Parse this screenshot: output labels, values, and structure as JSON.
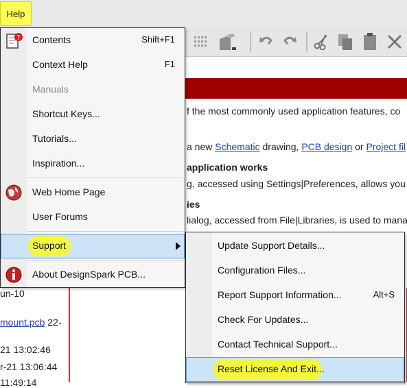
{
  "menubar": {
    "help_label": "Help"
  },
  "help_menu": {
    "items": [
      {
        "label": "Contents",
        "shortcut": "Shift+F1"
      },
      {
        "label": "Context Help",
        "shortcut": "F1"
      },
      {
        "label": "Manuals",
        "shortcut": ""
      },
      {
        "label": "Shortcut Keys...",
        "shortcut": ""
      },
      {
        "label": "Tutorials...",
        "shortcut": ""
      },
      {
        "label": "Inspiration...",
        "shortcut": ""
      },
      {
        "label": "Web Home Page",
        "shortcut": ""
      },
      {
        "label": "User Forums",
        "shortcut": ""
      },
      {
        "label": "Support",
        "shortcut": ""
      },
      {
        "label": "About DesignSpark PCB...",
        "shortcut": ""
      }
    ]
  },
  "support_submenu": {
    "items": [
      {
        "label": "Update Support Details...",
        "shortcut": ""
      },
      {
        "label": "Configuration Files...",
        "shortcut": ""
      },
      {
        "label": "Report Support Information...",
        "shortcut": "Alt+S"
      },
      {
        "label": "Check For Updates...",
        "shortcut": ""
      },
      {
        "label": "Contact Technical Support...",
        "shortcut": ""
      },
      {
        "label": "Reset License And Exit...",
        "shortcut": ""
      }
    ]
  },
  "document": {
    "line1": "f the most commonly used application features, co",
    "line2_prefix": "a new ",
    "line2_link1": "Schematic",
    "line2_mid1": " drawing, ",
    "line2_link2": "PCB design",
    "line2_mid2": " or ",
    "line2_link3": "Project fil",
    "heading1": "application works",
    "line3": "g, accessed using Settings|Preferences, allows you t",
    "heading2": "ies",
    "line4": "lialog, accessed from File|Libraries, is used to mana"
  },
  "left_list": {
    "row1": "un-10",
    "row2": "mount.pcb",
    "row2_suffix": " 22-",
    "row3": "21 13:02:46",
    "row4": "r-21 13:06:44",
    "row5": "11:49:14"
  },
  "colors": {
    "highlight_blue": "#cce4f7",
    "marker_yellow": "#f3f63a",
    "header_red": "#a00000"
  }
}
